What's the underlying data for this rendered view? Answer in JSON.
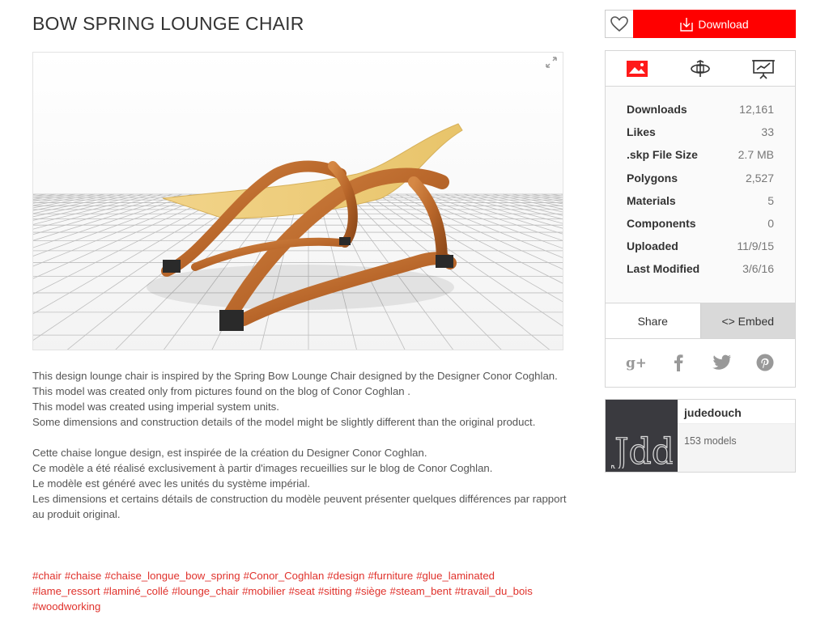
{
  "page": {
    "title": "BOW SPRING LOUNGE CHAIR"
  },
  "actions": {
    "download_label": "Download"
  },
  "stats": [
    {
      "label": "Downloads",
      "value": "12,161"
    },
    {
      "label": "Likes",
      "value": "33"
    },
    {
      "label": ".skp File Size",
      "value": "2.7 MB"
    },
    {
      "label": "Polygons",
      "value": "2,527"
    },
    {
      "label": "Materials",
      "value": "5"
    },
    {
      "label": "Components",
      "value": "0"
    },
    {
      "label": "Uploaded",
      "value": "11/9/15"
    },
    {
      "label": "Last Modified",
      "value": "3/6/16"
    }
  ],
  "share": {
    "share_label": "Share",
    "embed_label": "<> Embed"
  },
  "author": {
    "name": "judedouch",
    "models": "153 models",
    "avatar_text": "Jdd"
  },
  "description": {
    "en": [
      "This design lounge chair is inspired by the Spring Bow Lounge Chair designed by the Designer Conor Coghlan.",
      "This model was created only from pictures found on the blog of Conor Coghlan .",
      "This model was created using imperial system units.",
      "Some dimensions and construction details of the model might be slightly different than the original product."
    ],
    "fr": [
      "Cette chaise longue design, est inspirée de la création du Designer Conor Coghlan.",
      "Ce modèle a été réalisé exclusivement à partir d'images recueillies sur le blog de Conor Coghlan.",
      "Le modèle est généré avec les unités du système impérial.",
      "Les dimensions et certains détails de construction du modèle peuvent présenter quelques différences par rapport au produit original."
    ]
  },
  "tags": [
    "#chair",
    "#chaise",
    "#chaise_longue_bow_spring",
    "#Conor_Coghlan",
    "#design",
    "#furniture",
    "#glue_laminated",
    "#lame_ressort",
    "#laminé_collé",
    "#lounge_chair",
    "#mobilier",
    "#seat",
    "#sitting",
    "#siège",
    "#steam_bent",
    "#travail_du_bois",
    "#woodworking"
  ],
  "colors": {
    "accent": "#ff0000",
    "tag": "#e0322c"
  }
}
